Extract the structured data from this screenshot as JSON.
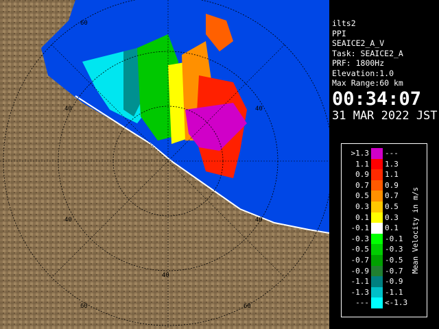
{
  "info": {
    "lines": [
      "ilts2",
      "PPI",
      "SEAICE2_A_V",
      "Task: SEAICE2_A",
      "PRF: 1800Hz",
      "Elevation:1.0",
      "Max Range:60 km"
    ],
    "time": "00:34:07",
    "date": "31 MAR 2022 JST"
  },
  "map": {
    "range_ring_labels": [
      "60",
      "40",
      "40",
      "40",
      "40",
      "60",
      "60"
    ]
  },
  "legend": {
    "title": "Mean Velocity in m/s",
    "rows": [
      {
        "lo": ">1.3",
        "hi": "---",
        "color": "#d000c8"
      },
      {
        "lo": "1.1",
        "hi": "1.3",
        "color": "#ff0000"
      },
      {
        "lo": "0.9",
        "hi": "1.1",
        "color": "#ff2a00"
      },
      {
        "lo": "0.7",
        "hi": "0.9",
        "color": "#ff5a00"
      },
      {
        "lo": "0.5",
        "hi": "0.7",
        "color": "#ff9000"
      },
      {
        "lo": "0.3",
        "hi": "0.5",
        "color": "#ffc800"
      },
      {
        "lo": "0.1",
        "hi": "0.3",
        "color": "#ffff00"
      },
      {
        "lo": "-0.1",
        "hi": "0.1",
        "color": "#ffffff"
      },
      {
        "lo": "-0.3",
        "hi": "-0.1",
        "color": "#00ff00"
      },
      {
        "lo": "-0.5",
        "hi": "-0.3",
        "color": "#00cc00"
      },
      {
        "lo": "-0.7",
        "hi": "-0.5",
        "color": "#00a000"
      },
      {
        "lo": "-0.9",
        "hi": "-0.7",
        "color": "#208030"
      },
      {
        "lo": "-1.1",
        "hi": "-0.9",
        "color": "#008080"
      },
      {
        "lo": "-1.3",
        "hi": "-1.1",
        "color": "#00c0c8"
      },
      {
        "lo": "---",
        "hi": "<-1.3",
        "color": "#00ffff"
      }
    ]
  }
}
